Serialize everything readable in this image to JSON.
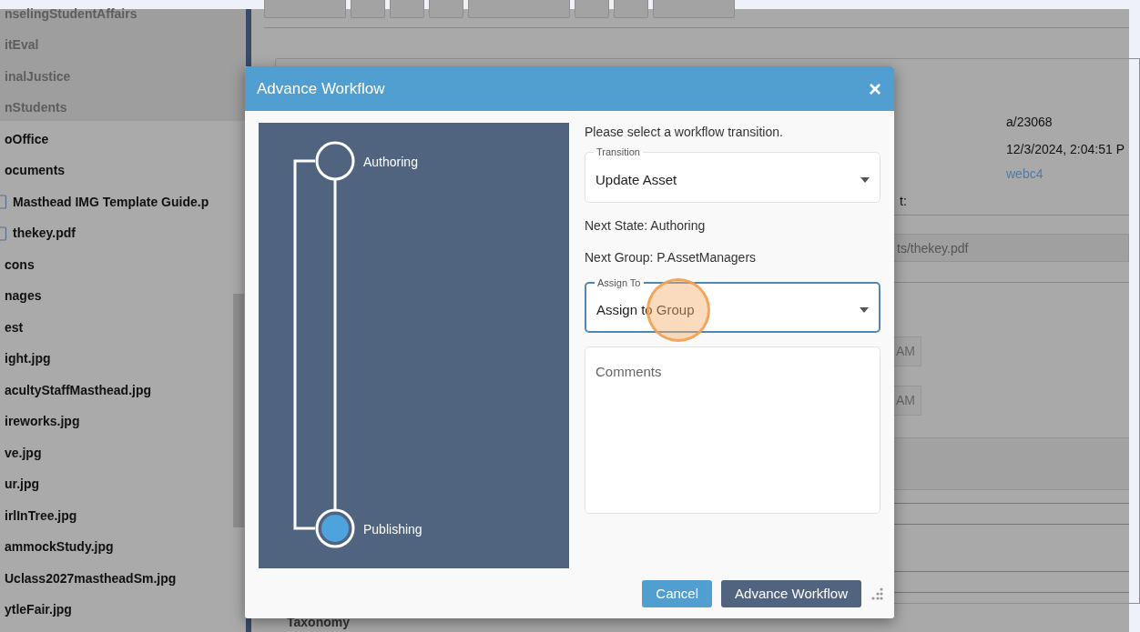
{
  "sidebar": {
    "items": [
      {
        "label": "nselingStudentAffairs",
        "dimmed": true,
        "kind": "plain"
      },
      {
        "label": "itEval",
        "dimmed": true,
        "kind": "plain"
      },
      {
        "label": "inalJustice",
        "dimmed": true,
        "kind": "plain"
      },
      {
        "label": "nStudents",
        "dimmed": true,
        "kind": "plain"
      },
      {
        "label": "oOffice",
        "dimmed": false,
        "kind": "plain"
      },
      {
        "label": "ocuments",
        "dimmed": false,
        "kind": "plain"
      },
      {
        "label": "Masthead IMG Template Guide.p",
        "dimmed": false,
        "kind": "file"
      },
      {
        "label": "thekey.pdf",
        "dimmed": false,
        "kind": "file"
      },
      {
        "label": "cons",
        "dimmed": false,
        "kind": "plain"
      },
      {
        "label": "nages",
        "dimmed": false,
        "kind": "plain"
      },
      {
        "label": "est",
        "dimmed": false,
        "kind": "plain"
      },
      {
        "label": "ight.jpg",
        "dimmed": false,
        "kind": "plain"
      },
      {
        "label": "acultyStaffMasthead.jpg",
        "dimmed": false,
        "kind": "plain"
      },
      {
        "label": "ireworks.jpg",
        "dimmed": false,
        "kind": "plain"
      },
      {
        "label": "ve.jpg",
        "dimmed": false,
        "kind": "plain"
      },
      {
        "label": "ur.jpg",
        "dimmed": false,
        "kind": "plain"
      },
      {
        "label": "irlInTree.jpg",
        "dimmed": false,
        "kind": "plain"
      },
      {
        "label": "ammockStudy.jpg",
        "dimmed": false,
        "kind": "plain"
      },
      {
        "label": "Uclass2027mastheadSm.jpg",
        "dimmed": false,
        "kind": "plain"
      },
      {
        "label": "ytleFair.jpg",
        "dimmed": false,
        "kind": "plain"
      }
    ]
  },
  "details": {
    "id": "a/23068",
    "date": "12/3/2024, 2:04:51 P",
    "user": "webc4",
    "label": "t:",
    "path": "ts/thekey.pdf",
    "times": [
      "AM",
      "AM"
    ],
    "section": "Taxonomy"
  },
  "dialog": {
    "title": "Advance Workflow",
    "close": "×",
    "states": [
      {
        "label": "Authoring",
        "current": false
      },
      {
        "label": "Publishing",
        "current": true
      }
    ],
    "prompt": "Please select a workflow transition.",
    "transition": {
      "label": "Transition",
      "value": "Update Asset",
      "focused": false
    },
    "next_state": "Next State: Authoring",
    "next_group": "Next Group: P.AssetManagers",
    "assign_to": {
      "label": "Assign To",
      "value": "Assign to Group",
      "focused": true
    },
    "comments": {
      "placeholder": "Comments"
    },
    "buttons": [
      {
        "label": "Cancel",
        "kind": "secondary"
      },
      {
        "label": "Advance Workflow",
        "kind": "primary"
      }
    ]
  }
}
